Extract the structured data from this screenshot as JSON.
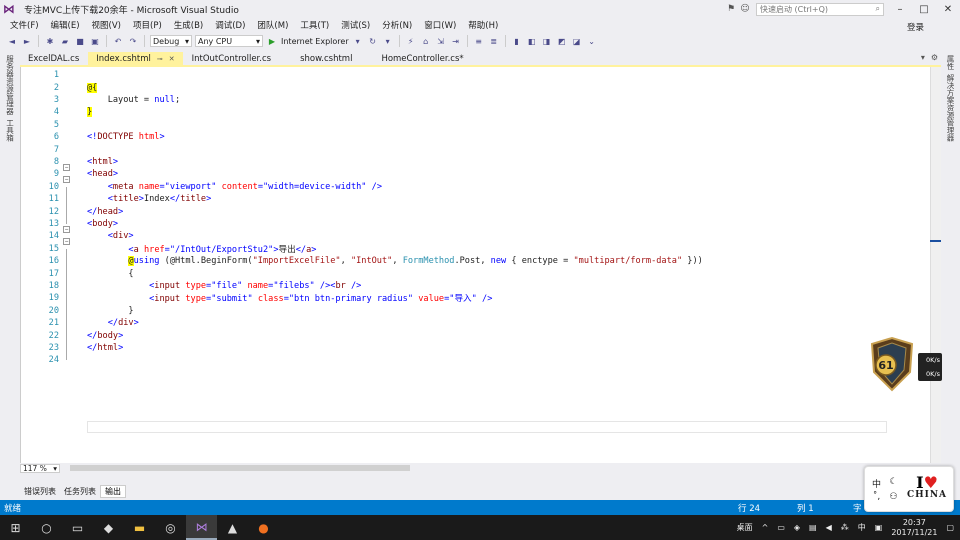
{
  "window": {
    "title": "专注MVC上传下载20余年 - Microsoft Visual Studio",
    "quick_launch_placeholder": "快速启动 (Ctrl+Q)",
    "login_label": "登录"
  },
  "menu": [
    "文件(F)",
    "编辑(E)",
    "视图(V)",
    "项目(P)",
    "生成(B)",
    "调试(D)",
    "团队(M)",
    "工具(T)",
    "测试(S)",
    "分析(N)",
    "窗口(W)",
    "帮助(H)"
  ],
  "toolbar": {
    "config": "Debug",
    "platform": "Any CPU",
    "browser": "Internet Explorer"
  },
  "left_rail": [
    "服务器资源管理器",
    "工具箱"
  ],
  "right_rail": [
    "属性",
    "解决方案资源管理器"
  ],
  "tabs": [
    {
      "label": "ExcelDAL.cs",
      "active": false
    },
    {
      "label": "Index.cshtml",
      "active": true
    },
    {
      "label": "IntOutController.cs",
      "active": false
    },
    {
      "label": "show.cshtml",
      "active": false
    },
    {
      "label": "HomeController.cs*",
      "active": false
    }
  ],
  "code_lines": [
    {
      "n": "1",
      "parts": []
    },
    {
      "n": "2",
      "parts": [
        {
          "c": "raz",
          "t": "@{"
        }
      ]
    },
    {
      "n": "3",
      "parts": [
        {
          "c": "",
          "t": "    Layout = "
        },
        {
          "c": "k",
          "t": "null"
        },
        {
          "c": "",
          "t": ";"
        }
      ]
    },
    {
      "n": "4",
      "parts": [
        {
          "c": "raz",
          "t": "}"
        }
      ]
    },
    {
      "n": "5",
      "parts": []
    },
    {
      "n": "6",
      "parts": [
        {
          "c": "s",
          "t": "<!"
        },
        {
          "c": "t",
          "t": "DOCTYPE"
        },
        {
          "c": "",
          "t": " "
        },
        {
          "c": "a",
          "t": "html"
        },
        {
          "c": "s",
          "t": ">"
        }
      ]
    },
    {
      "n": "7",
      "parts": []
    },
    {
      "n": "8",
      "parts": [
        {
          "c": "s",
          "t": "<"
        },
        {
          "c": "t",
          "t": "html"
        },
        {
          "c": "s",
          "t": ">"
        }
      ]
    },
    {
      "n": "9",
      "parts": [
        {
          "c": "s",
          "t": "<"
        },
        {
          "c": "t",
          "t": "head"
        },
        {
          "c": "s",
          "t": ">"
        }
      ]
    },
    {
      "n": "10",
      "parts": [
        {
          "c": "",
          "t": "    "
        },
        {
          "c": "s",
          "t": "<"
        },
        {
          "c": "t",
          "t": "meta"
        },
        {
          "c": "",
          "t": " "
        },
        {
          "c": "a",
          "t": "name"
        },
        {
          "c": "s",
          "t": "=\"viewport\""
        },
        {
          "c": "",
          "t": " "
        },
        {
          "c": "a",
          "t": "content"
        },
        {
          "c": "s",
          "t": "=\"width=device-width\""
        },
        {
          "c": "",
          "t": " "
        },
        {
          "c": "s",
          "t": "/>"
        }
      ]
    },
    {
      "n": "11",
      "parts": [
        {
          "c": "",
          "t": "    "
        },
        {
          "c": "s",
          "t": "<"
        },
        {
          "c": "t",
          "t": "title"
        },
        {
          "c": "s",
          "t": ">"
        },
        {
          "c": "",
          "t": "Index"
        },
        {
          "c": "s",
          "t": "</"
        },
        {
          "c": "t",
          "t": "title"
        },
        {
          "c": "s",
          "t": ">"
        }
      ]
    },
    {
      "n": "12",
      "parts": [
        {
          "c": "s",
          "t": "</"
        },
        {
          "c": "t",
          "t": "head"
        },
        {
          "c": "s",
          "t": ">"
        }
      ]
    },
    {
      "n": "13",
      "parts": [
        {
          "c": "s",
          "t": "<"
        },
        {
          "c": "t",
          "t": "body"
        },
        {
          "c": "s",
          "t": ">"
        }
      ]
    },
    {
      "n": "14",
      "parts": [
        {
          "c": "",
          "t": "    "
        },
        {
          "c": "s",
          "t": "<"
        },
        {
          "c": "t",
          "t": "div"
        },
        {
          "c": "s",
          "t": ">"
        }
      ]
    },
    {
      "n": "15",
      "parts": [
        {
          "c": "",
          "t": "        "
        },
        {
          "c": "s",
          "t": "<"
        },
        {
          "c": "t",
          "t": "a"
        },
        {
          "c": "",
          "t": " "
        },
        {
          "c": "a",
          "t": "href"
        },
        {
          "c": "s",
          "t": "=\"/IntOut/ExportStu2\">"
        },
        {
          "c": "",
          "t": "导出"
        },
        {
          "c": "s",
          "t": "</"
        },
        {
          "c": "t",
          "t": "a"
        },
        {
          "c": "s",
          "t": ">"
        }
      ]
    },
    {
      "n": "16",
      "parts": [
        {
          "c": "",
          "t": "        "
        },
        {
          "c": "raz",
          "t": "@"
        },
        {
          "c": "k",
          "t": "using"
        },
        {
          "c": "",
          "t": " (@Html.BeginForm("
        },
        {
          "c": "st",
          "t": "\"ImportExcelFile\""
        },
        {
          "c": "",
          "t": ", "
        },
        {
          "c": "st",
          "t": "\"IntOut\""
        },
        {
          "c": "",
          "t": ", "
        },
        {
          "c": "cls",
          "t": "FormMethod"
        },
        {
          "c": "",
          "t": ".Post, "
        },
        {
          "c": "k",
          "t": "new"
        },
        {
          "c": "",
          "t": " { enctype = "
        },
        {
          "c": "st",
          "t": "\"multipart/form-data\""
        },
        {
          "c": "",
          "t": " }))"
        }
      ]
    },
    {
      "n": "17",
      "parts": [
        {
          "c": "",
          "t": "        {"
        }
      ]
    },
    {
      "n": "18",
      "parts": [
        {
          "c": "",
          "t": "            "
        },
        {
          "c": "s",
          "t": "<"
        },
        {
          "c": "t",
          "t": "input"
        },
        {
          "c": "",
          "t": " "
        },
        {
          "c": "a",
          "t": "type"
        },
        {
          "c": "s",
          "t": "=\"file\""
        },
        {
          "c": "",
          "t": " "
        },
        {
          "c": "a",
          "t": "name"
        },
        {
          "c": "s",
          "t": "=\"filebs\""
        },
        {
          "c": "",
          "t": " "
        },
        {
          "c": "s",
          "t": "/><"
        },
        {
          "c": "t",
          "t": "br"
        },
        {
          "c": "",
          "t": " "
        },
        {
          "c": "s",
          "t": "/>"
        }
      ]
    },
    {
      "n": "19",
      "parts": [
        {
          "c": "",
          "t": "            "
        },
        {
          "c": "s",
          "t": "<"
        },
        {
          "c": "t",
          "t": "input"
        },
        {
          "c": "",
          "t": " "
        },
        {
          "c": "a",
          "t": "type"
        },
        {
          "c": "s",
          "t": "=\"submit\""
        },
        {
          "c": "",
          "t": " "
        },
        {
          "c": "a",
          "t": "class"
        },
        {
          "c": "s",
          "t": "=\"btn btn-primary radius\""
        },
        {
          "c": "",
          "t": " "
        },
        {
          "c": "a",
          "t": "value"
        },
        {
          "c": "s",
          "t": "=\"导入\""
        },
        {
          "c": "",
          "t": " "
        },
        {
          "c": "s",
          "t": "/>"
        }
      ]
    },
    {
      "n": "20",
      "parts": [
        {
          "c": "",
          "t": "        }"
        }
      ]
    },
    {
      "n": "21",
      "parts": [
        {
          "c": "",
          "t": "    "
        },
        {
          "c": "s",
          "t": "</"
        },
        {
          "c": "t",
          "t": "div"
        },
        {
          "c": "s",
          "t": ">"
        }
      ]
    },
    {
      "n": "22",
      "parts": [
        {
          "c": "s",
          "t": "</"
        },
        {
          "c": "t",
          "t": "body"
        },
        {
          "c": "s",
          "t": ">"
        }
      ]
    },
    {
      "n": "23",
      "parts": [
        {
          "c": "s",
          "t": "</"
        },
        {
          "c": "t",
          "t": "html"
        },
        {
          "c": "s",
          "t": ">"
        }
      ]
    },
    {
      "n": "24",
      "parts": []
    }
  ],
  "editor": {
    "zoom": "117 %"
  },
  "bottom_tabs": [
    {
      "label": "错误列表",
      "active": false
    },
    {
      "label": "任务列表",
      "active": false
    },
    {
      "label": "输出",
      "active": true
    }
  ],
  "status": {
    "text": "就绪",
    "line": "行 24",
    "col": "列 1",
    "char": "字"
  },
  "overlay": {
    "badge_level": "61",
    "net_up": "0K/s",
    "net_down": "0K/s",
    "ime_lang": "中",
    "ime_china": "CHINA",
    "ime_i": "I"
  },
  "taskbar": {
    "tray_desktop": "桌面",
    "time": "20:37",
    "date": "2017/11/21"
  }
}
